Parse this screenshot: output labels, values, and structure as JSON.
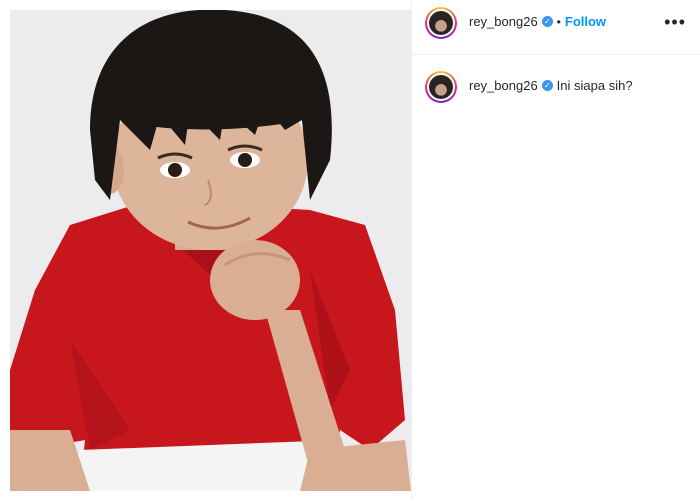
{
  "post": {
    "username": "rey_bong26",
    "follow_label": "Follow",
    "separator": "•",
    "more_label": "•••",
    "verified_symbol": "✓",
    "caption": "Ini siapa sih?"
  },
  "colors": {
    "follow": "#0095f6",
    "verified": "#3897f0",
    "shirt": "#c8171c",
    "photo_background": "#ececef"
  }
}
